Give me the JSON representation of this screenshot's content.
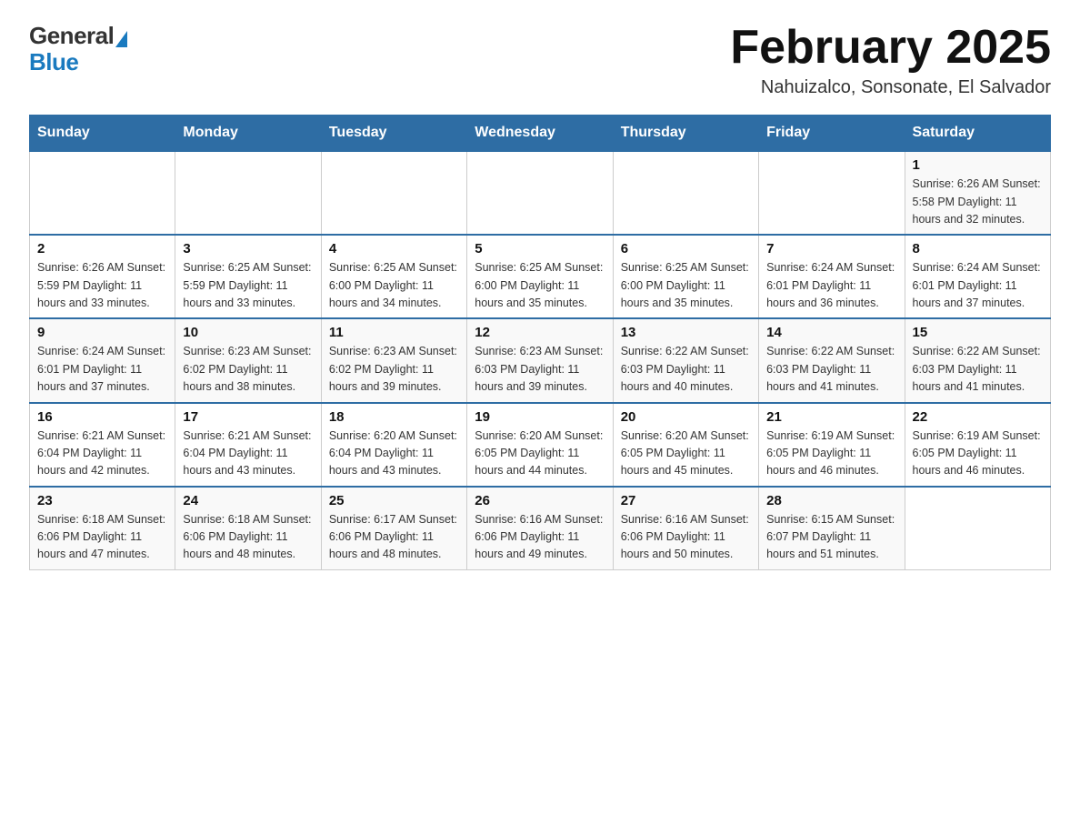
{
  "header": {
    "logo": {
      "general_text": "General",
      "blue_text": "Blue"
    },
    "title": "February 2025",
    "subtitle": "Nahuizalco, Sonsonate, El Salvador"
  },
  "calendar": {
    "days_of_week": [
      "Sunday",
      "Monday",
      "Tuesday",
      "Wednesday",
      "Thursday",
      "Friday",
      "Saturday"
    ],
    "weeks": [
      [
        {
          "day": "",
          "info": ""
        },
        {
          "day": "",
          "info": ""
        },
        {
          "day": "",
          "info": ""
        },
        {
          "day": "",
          "info": ""
        },
        {
          "day": "",
          "info": ""
        },
        {
          "day": "",
          "info": ""
        },
        {
          "day": "1",
          "info": "Sunrise: 6:26 AM\nSunset: 5:58 PM\nDaylight: 11 hours\nand 32 minutes."
        }
      ],
      [
        {
          "day": "2",
          "info": "Sunrise: 6:26 AM\nSunset: 5:59 PM\nDaylight: 11 hours\nand 33 minutes."
        },
        {
          "day": "3",
          "info": "Sunrise: 6:25 AM\nSunset: 5:59 PM\nDaylight: 11 hours\nand 33 minutes."
        },
        {
          "day": "4",
          "info": "Sunrise: 6:25 AM\nSunset: 6:00 PM\nDaylight: 11 hours\nand 34 minutes."
        },
        {
          "day": "5",
          "info": "Sunrise: 6:25 AM\nSunset: 6:00 PM\nDaylight: 11 hours\nand 35 minutes."
        },
        {
          "day": "6",
          "info": "Sunrise: 6:25 AM\nSunset: 6:00 PM\nDaylight: 11 hours\nand 35 minutes."
        },
        {
          "day": "7",
          "info": "Sunrise: 6:24 AM\nSunset: 6:01 PM\nDaylight: 11 hours\nand 36 minutes."
        },
        {
          "day": "8",
          "info": "Sunrise: 6:24 AM\nSunset: 6:01 PM\nDaylight: 11 hours\nand 37 minutes."
        }
      ],
      [
        {
          "day": "9",
          "info": "Sunrise: 6:24 AM\nSunset: 6:01 PM\nDaylight: 11 hours\nand 37 minutes."
        },
        {
          "day": "10",
          "info": "Sunrise: 6:23 AM\nSunset: 6:02 PM\nDaylight: 11 hours\nand 38 minutes."
        },
        {
          "day": "11",
          "info": "Sunrise: 6:23 AM\nSunset: 6:02 PM\nDaylight: 11 hours\nand 39 minutes."
        },
        {
          "day": "12",
          "info": "Sunrise: 6:23 AM\nSunset: 6:03 PM\nDaylight: 11 hours\nand 39 minutes."
        },
        {
          "day": "13",
          "info": "Sunrise: 6:22 AM\nSunset: 6:03 PM\nDaylight: 11 hours\nand 40 minutes."
        },
        {
          "day": "14",
          "info": "Sunrise: 6:22 AM\nSunset: 6:03 PM\nDaylight: 11 hours\nand 41 minutes."
        },
        {
          "day": "15",
          "info": "Sunrise: 6:22 AM\nSunset: 6:03 PM\nDaylight: 11 hours\nand 41 minutes."
        }
      ],
      [
        {
          "day": "16",
          "info": "Sunrise: 6:21 AM\nSunset: 6:04 PM\nDaylight: 11 hours\nand 42 minutes."
        },
        {
          "day": "17",
          "info": "Sunrise: 6:21 AM\nSunset: 6:04 PM\nDaylight: 11 hours\nand 43 minutes."
        },
        {
          "day": "18",
          "info": "Sunrise: 6:20 AM\nSunset: 6:04 PM\nDaylight: 11 hours\nand 43 minutes."
        },
        {
          "day": "19",
          "info": "Sunrise: 6:20 AM\nSunset: 6:05 PM\nDaylight: 11 hours\nand 44 minutes."
        },
        {
          "day": "20",
          "info": "Sunrise: 6:20 AM\nSunset: 6:05 PM\nDaylight: 11 hours\nand 45 minutes."
        },
        {
          "day": "21",
          "info": "Sunrise: 6:19 AM\nSunset: 6:05 PM\nDaylight: 11 hours\nand 46 minutes."
        },
        {
          "day": "22",
          "info": "Sunrise: 6:19 AM\nSunset: 6:05 PM\nDaylight: 11 hours\nand 46 minutes."
        }
      ],
      [
        {
          "day": "23",
          "info": "Sunrise: 6:18 AM\nSunset: 6:06 PM\nDaylight: 11 hours\nand 47 minutes."
        },
        {
          "day": "24",
          "info": "Sunrise: 6:18 AM\nSunset: 6:06 PM\nDaylight: 11 hours\nand 48 minutes."
        },
        {
          "day": "25",
          "info": "Sunrise: 6:17 AM\nSunset: 6:06 PM\nDaylight: 11 hours\nand 48 minutes."
        },
        {
          "day": "26",
          "info": "Sunrise: 6:16 AM\nSunset: 6:06 PM\nDaylight: 11 hours\nand 49 minutes."
        },
        {
          "day": "27",
          "info": "Sunrise: 6:16 AM\nSunset: 6:06 PM\nDaylight: 11 hours\nand 50 minutes."
        },
        {
          "day": "28",
          "info": "Sunrise: 6:15 AM\nSunset: 6:07 PM\nDaylight: 11 hours\nand 51 minutes."
        },
        {
          "day": "",
          "info": ""
        }
      ]
    ]
  }
}
